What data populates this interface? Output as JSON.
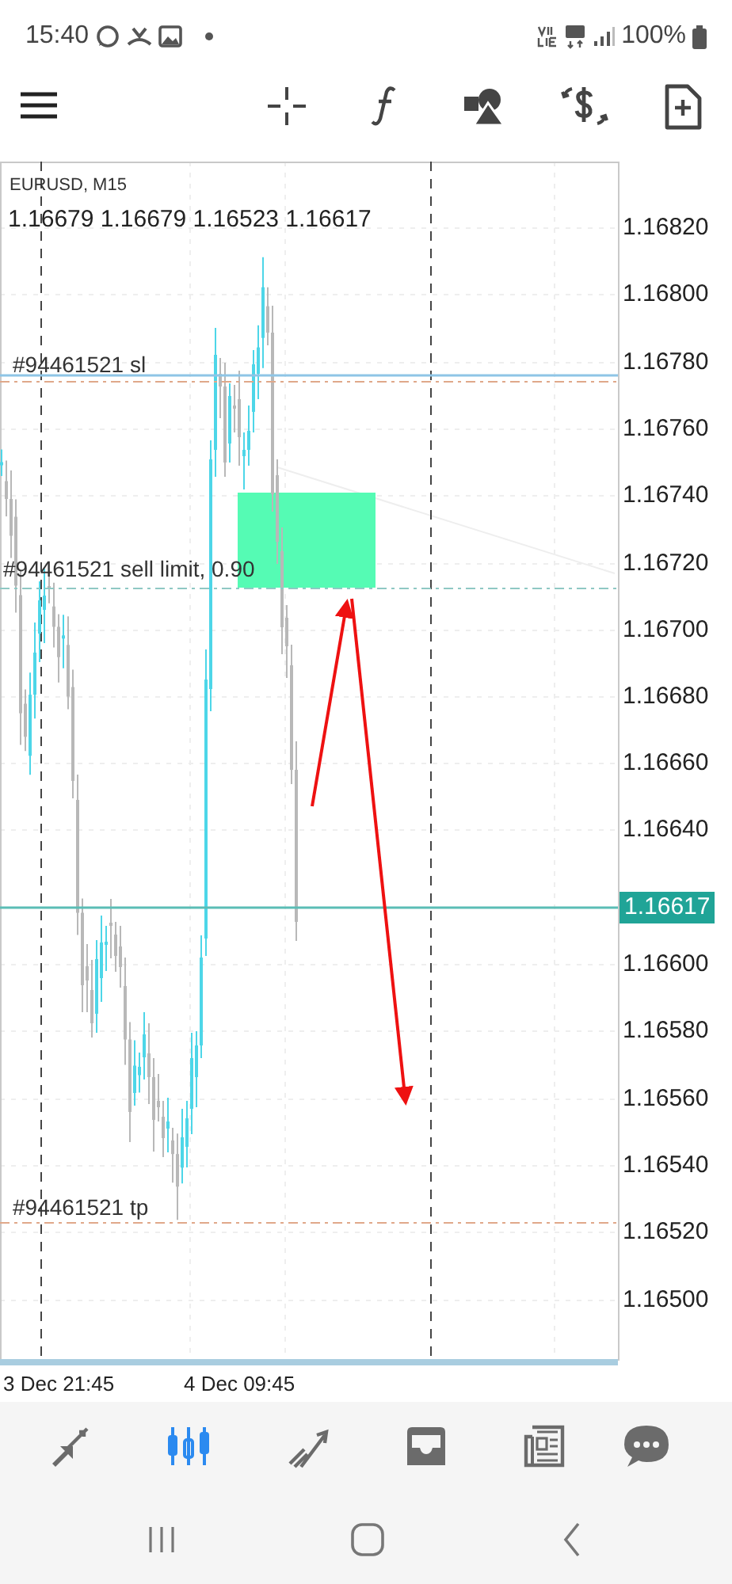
{
  "status_bar": {
    "time": "15:40",
    "battery": "100%"
  },
  "chart": {
    "symbol": "EURUSD, M15",
    "ohlc": "1.16679 1.16679 1.16523 1.16617",
    "price_axis": [
      "1.16820",
      "1.16800",
      "1.16780",
      "1.16760",
      "1.16740",
      "1.16720",
      "1.16700",
      "1.16680",
      "1.16660",
      "1.16640",
      "1.16600",
      "1.16580",
      "1.16560",
      "1.16540",
      "1.16520",
      "1.16500"
    ],
    "current_price": "1.16617",
    "order_lines": [
      {
        "kind": "sl",
        "label": "#94461521 sl"
      },
      {
        "kind": "sell_limit",
        "label": "#94461521 sell limit, 0.90"
      },
      {
        "kind": "tp",
        "label": "#94461521 tp"
      }
    ],
    "time_axis": [
      "3 Dec 21:45",
      "4 Dec 09:45"
    ]
  },
  "bottom_nav": [
    {
      "selected": false
    },
    {
      "selected": true
    },
    {
      "selected": false
    },
    {
      "selected": false
    },
    {
      "selected": false
    },
    {
      "selected": false
    }
  ]
}
